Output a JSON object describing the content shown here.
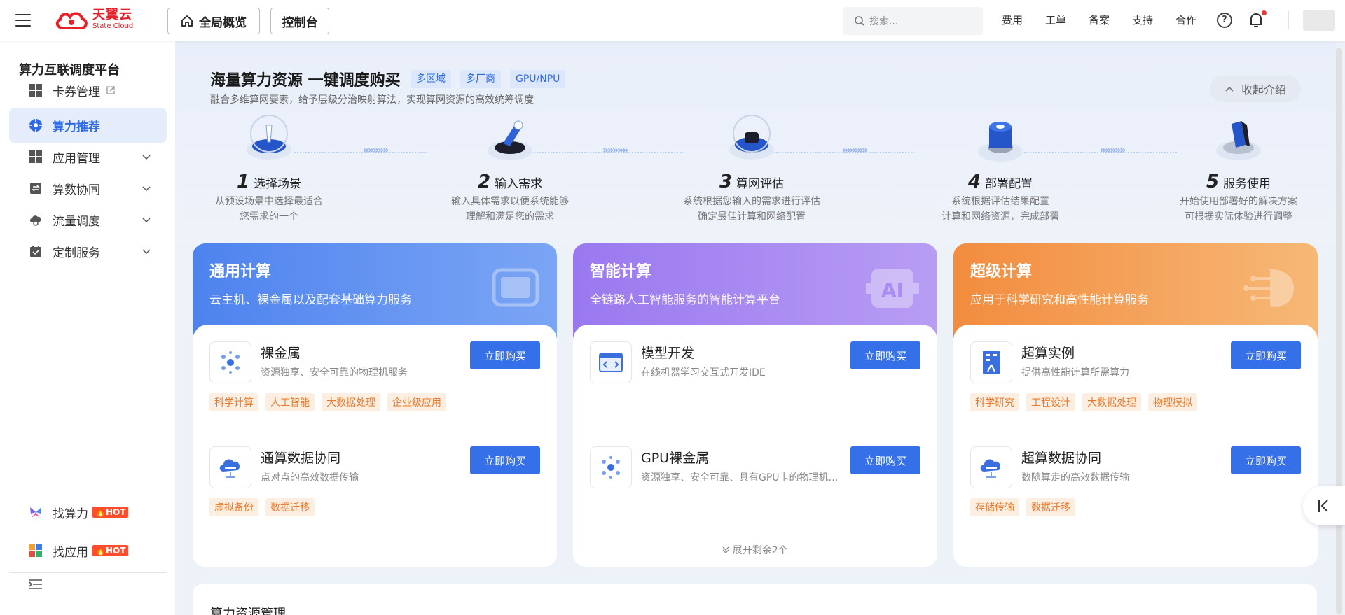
{
  "topbar": {
    "logo_cn": "天翼云",
    "logo_en": "State Cloud",
    "overview_btn": "全局概览",
    "console_btn": "控制台",
    "search_placeholder": "搜索...",
    "links": [
      "费用",
      "工单",
      "备案",
      "支持",
      "合作"
    ],
    "help_glyph": "?"
  },
  "sidebar": {
    "title": "算力互联调度平台",
    "items": [
      {
        "label": "卡券管理",
        "icon": "grid-icon",
        "external": true
      },
      {
        "label": "算力推荐",
        "icon": "recommend-icon",
        "active": true
      },
      {
        "label": "应用管理",
        "icon": "grid-icon",
        "expandable": true
      },
      {
        "label": "算数协同",
        "icon": "sync-icon",
        "expandable": true
      },
      {
        "label": "流量调度",
        "icon": "cloud-flow-icon",
        "expandable": true
      },
      {
        "label": "定制服务",
        "icon": "calendar-check-icon",
        "expandable": true
      }
    ],
    "bottom_items": [
      {
        "label": "找算力",
        "badge": "HOT"
      },
      {
        "label": "找应用",
        "badge": "HOT"
      }
    ]
  },
  "intro": {
    "title": "海量算力资源 一键调度购买",
    "tags": [
      "多区域",
      "多厂商",
      "GPU/NPU"
    ],
    "subtitle": "融合多维算网要素，给予层级分治映射算法，实现算网资源的高效统筹调度",
    "collapse_label": "收起介绍",
    "steps": [
      {
        "num": "1",
        "title": "选择场景",
        "desc1": "从预设场景中选择最适合",
        "desc2": "您需求的一个"
      },
      {
        "num": "2",
        "title": "输入需求",
        "desc1": "输入具体需求以便系统能够",
        "desc2": "理解和满足您的需求"
      },
      {
        "num": "3",
        "title": "算网评估",
        "desc1": "系统根据您输入的需求进行评估",
        "desc2": "确定最佳计算和网络配置"
      },
      {
        "num": "4",
        "title": "部署配置",
        "desc1": "系统根据评估结果配置",
        "desc2": "计算和网络资源，完成部署"
      },
      {
        "num": "5",
        "title": "服务使用",
        "desc1": "开始使用部署好的解决方案",
        "desc2": "可根据实际体验进行调整"
      }
    ],
    "arrows": "»»»»»"
  },
  "cards": [
    {
      "title": "通用计算",
      "subtitle": "云主机、裸金属以及配套基础算力服务",
      "color": "#5b8ef0",
      "products": [
        {
          "name": "裸金属",
          "desc": "资源独享、安全可靠的物理机服务",
          "buy": "立即购买",
          "tags": [
            "科学计算",
            "人工智能",
            "大数据处理",
            "企业级应用"
          ]
        },
        {
          "name": "通算数据协同",
          "desc": "点对点的高效数据传输",
          "buy": "立即购买",
          "tags": [
            "虚拟备份",
            "数据迁移"
          ]
        }
      ]
    },
    {
      "title": "智能计算",
      "subtitle": "全链路人工智能服务的智能计算平台",
      "color": "#9b7cf0",
      "products": [
        {
          "name": "模型开发",
          "desc": "在线机器学习交互式开发IDE",
          "buy": "立即购买",
          "tags": []
        },
        {
          "name": "GPU裸金属",
          "desc": "资源独享、安全可靠、具有GPU卡的物理机服务",
          "buy": "立即购买",
          "tags": []
        }
      ],
      "expand_label": "展开剩余2个"
    },
    {
      "title": "超级计算",
      "subtitle": "应用于科学研究和高性能计算服务",
      "color": "#f39a4c",
      "products": [
        {
          "name": "超算实例",
          "desc": "提供高性能计算所需算力",
          "buy": "立即购买",
          "tags": [
            "科学研究",
            "工程设计",
            "大数据处理",
            "物理模拟"
          ]
        },
        {
          "name": "超算数据协同",
          "desc": "数随算走的高效数据传输",
          "buy": "立即购买",
          "tags": [
            "存储传输",
            "数据迁移"
          ]
        }
      ]
    }
  ],
  "bottom": {
    "title": "算力资源管理"
  }
}
